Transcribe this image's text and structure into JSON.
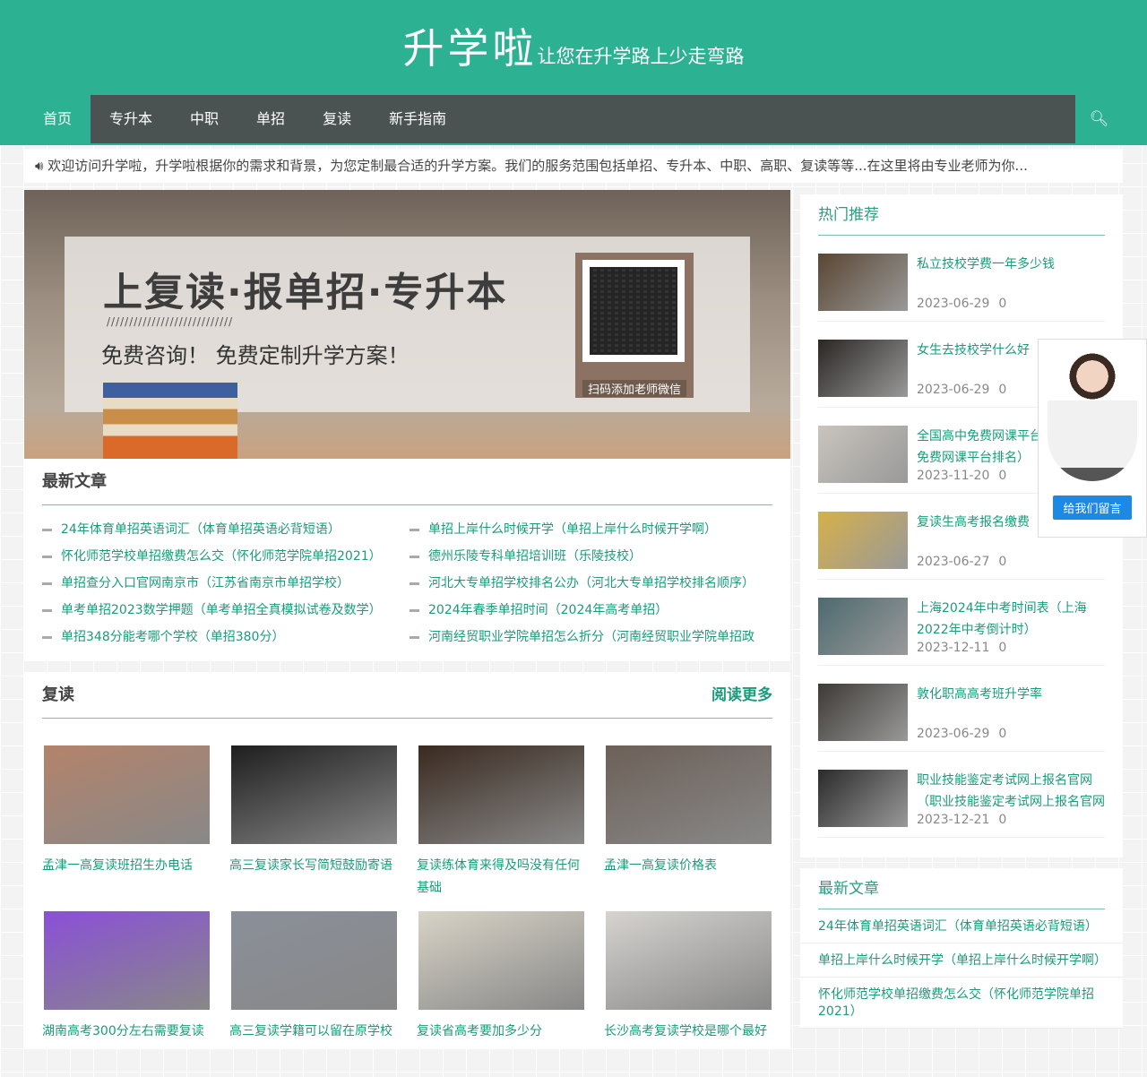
{
  "header": {
    "logo": "升学啦",
    "slogan": "让您在升学路上少走弯路"
  },
  "nav": {
    "items": [
      "首页",
      "专升本",
      "中职",
      "单招",
      "复读",
      "新手指南"
    ],
    "active": 0,
    "search_icon": "search-icon"
  },
  "notice": {
    "icon": "speaker-icon",
    "text": "欢迎访问升学啦，升学啦根据你的需求和背景，为您定制最合适的升学方案。我们的服务范围包括单招、专升本、中职、高职、复读等等...在这里将由专业老师为你..."
  },
  "banner": {
    "headline": "上复读·报单招·专升本",
    "slashes": "////////////////////////////",
    "sub": "免费咨询！ 免费定制升学方案！",
    "qr_caption": "扫码添加老师微信"
  },
  "latest": {
    "title": "最新文章",
    "items": [
      "24年体育单招英语词汇（体育单招英语必背短语）",
      "单招上岸什么时候开学（单招上岸什么时候开学啊）",
      "怀化师范学校单招缴费怎么交（怀化师范学院单招2021）",
      "德州乐陵专科单招培训班（乐陵技校）",
      "单招查分入口官网南京市（江苏省南京市单招学校）",
      "河北大专单招学校排名公办（河北大专单招学校排名顺序）",
      "单考单招2023数学押题（单考单招全真模拟试卷及数学）",
      "2024年春季单招时间（2024年高考单招）",
      "单招348分能考哪个学校（单招380分）",
      "河南经贸职业学院单招怎么折分（河南经贸职业学院单招政"
    ]
  },
  "fudu": {
    "title": "复读",
    "more": "阅读更多",
    "items": [
      {
        "title": "孟津一高复读班招生办电话",
        "color": "#b4836a"
      },
      {
        "title": "高三复读家长写简短鼓励寄语",
        "color": "#1e1e1e"
      },
      {
        "title": "复读练体育来得及吗没有任何基础",
        "color": "#3a2a20"
      },
      {
        "title": "孟津一高复读价格表",
        "color": "#6d6058"
      },
      {
        "title": "湖南高考300分左右需要复读",
        "color": "#8a4fd8"
      },
      {
        "title": "高三复读学籍可以留在原学校",
        "color": "#8a8f99"
      },
      {
        "title": "复读省高考要加多少分",
        "color": "#d8d3c6"
      },
      {
        "title": "长沙高考复读学校是哪个最好",
        "color": "#d6d3d0"
      }
    ]
  },
  "hot": {
    "title": "热门推荐",
    "items": [
      {
        "title": "私立技校学费一年多少钱",
        "date": "2023-06-29",
        "count": "0",
        "color": "#5a4632"
      },
      {
        "title": "女生去技校学什么好",
        "date": "2023-06-29",
        "count": "0",
        "color": "#2a2624"
      },
      {
        "title": "全国高中免费网课平台（全国高中免费网课平台排名）",
        "date": "2023-11-20",
        "count": "0",
        "color": "#c9c4bd"
      },
      {
        "title": "复读生高考报名缴费",
        "date": "2023-06-27",
        "count": "0",
        "color": "#d6b04a"
      },
      {
        "title": "上海2024年中考时间表（上海2022年中考倒计时）",
        "date": "2023-12-11",
        "count": "0",
        "color": "#4d6a70"
      },
      {
        "title": "敦化职高高考班升学率",
        "date": "2023-06-29",
        "count": "0",
        "color": "#3e3a36"
      },
      {
        "title": "职业技能鉴定考试网上报名官网（职业技能鉴定考试网上报名官网",
        "date": "2023-12-21",
        "count": "0",
        "color": "#2b2b2b"
      }
    ]
  },
  "side_latest": {
    "title": "最新文章",
    "items": [
      "24年体育单招英语词汇（体育单招英语必背短语）",
      "单招上岸什么时候开学（单招上岸什么时候开学啊）",
      "怀化师范学校单招缴费怎么交（怀化师范学院单招2021）"
    ]
  },
  "kefu": {
    "button": "给我们留言"
  },
  "colors": {
    "brand": "#2db193",
    "nav": "#4a5252",
    "link": "#1a9b7c"
  }
}
